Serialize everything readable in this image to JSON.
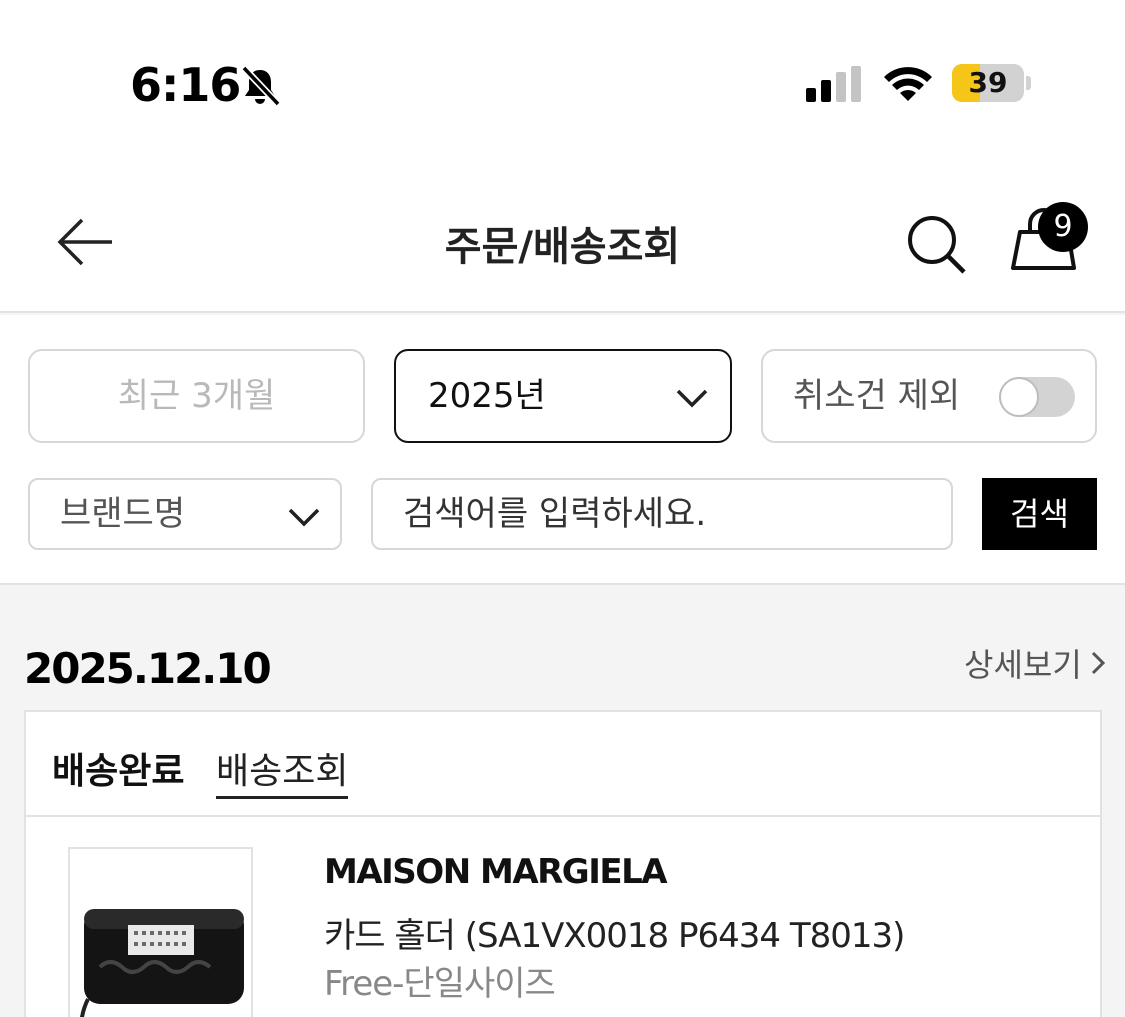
{
  "status_bar": {
    "time": "6:16",
    "battery_level": "39",
    "battery_fraction": 0.39,
    "icons": [
      "bell-muted-icon",
      "cellular-signal-icon",
      "wifi-icon",
      "battery-icon"
    ]
  },
  "header": {
    "title": "주문/배송조회",
    "cart_count": "9",
    "icons": [
      "back-arrow-icon",
      "search-icon",
      "shopping-bag-icon"
    ]
  },
  "filters": {
    "recent_period": "최근 3개월",
    "year": "2025년",
    "exclude_cancelled_label": "취소건 제외",
    "exclude_cancelled_on": false,
    "brand_select": "브랜드명",
    "search_placeholder": "검색어를 입력하세요.",
    "search_button": "검색"
  },
  "orders": [
    {
      "date": "2025.12.10",
      "detail_link": "상세보기",
      "status": "배송완료",
      "tracking_link": "배송조회",
      "item": {
        "brand": "MAISON MARGIELA",
        "name": "카드 홀더 (SA1VX0018 P6434 T8013)",
        "option": "Free-단일사이즈"
      }
    }
  ],
  "colors": {
    "accent": "#000000",
    "battery_fill": "#f5c518",
    "border": "#d7d7d7",
    "page_background": "#f4f4f4"
  }
}
